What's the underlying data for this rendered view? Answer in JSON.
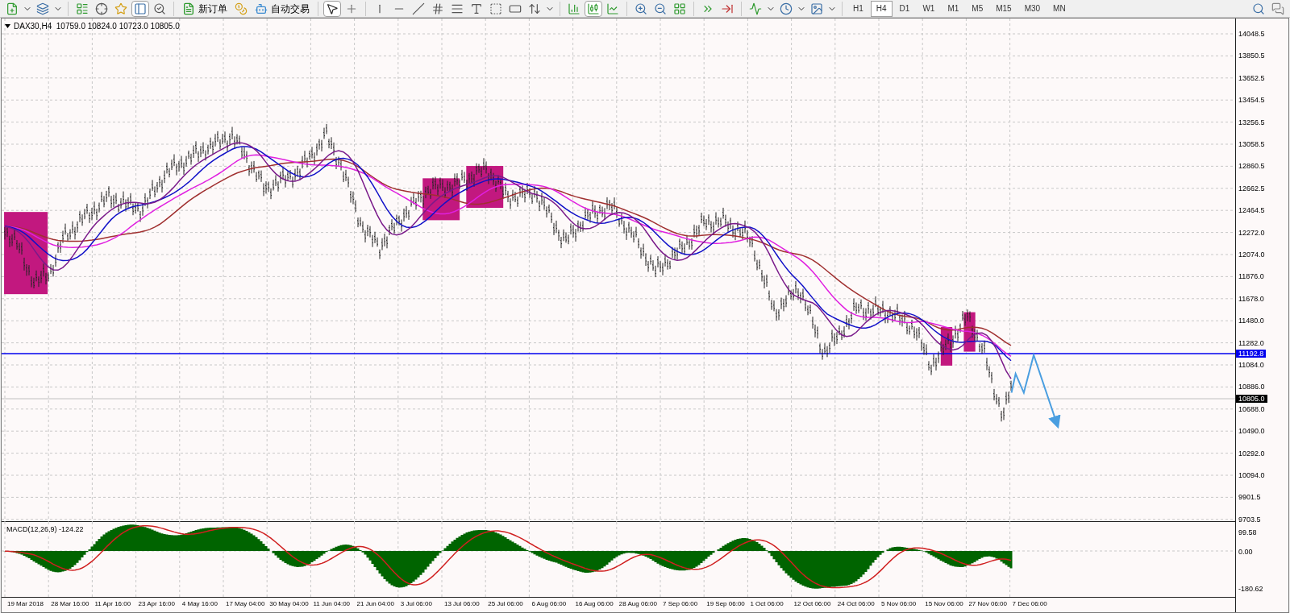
{
  "toolbar": {
    "buttons": [
      {
        "label": "新订单"
      },
      {
        "label": "自动交易"
      }
    ],
    "timeframes": [
      {
        "label": "H1",
        "selected": false
      },
      {
        "label": "H4",
        "selected": true
      },
      {
        "label": "D1",
        "selected": false
      },
      {
        "label": "W1",
        "selected": false
      },
      {
        "label": "M1",
        "selected": false
      },
      {
        "label": "M5",
        "selected": false
      },
      {
        "label": "M15",
        "selected": false
      },
      {
        "label": "M30",
        "selected": false
      },
      {
        "label": "MN",
        "selected": false
      }
    ]
  },
  "chart": {
    "header": "DAX30,H4  10759.0 10824.0 10723.0 10805.0",
    "price_axis": [
      "14048.5",
      "13850.5",
      "13652.5",
      "13454.5",
      "13256.5",
      "13058.5",
      "12860.5",
      "12662.5",
      "12464.5",
      "12272.0",
      "12074.0",
      "11876.0",
      "11678.0",
      "11480.0",
      "11282.0",
      "11084.0",
      "10886.0",
      "10688.0",
      "10490.0",
      "10292.0",
      "10094.0",
      "9901.5",
      "9703.5"
    ],
    "markers": [
      {
        "kind": "line",
        "text": "11192.8"
      },
      {
        "kind": "price",
        "text": "10805.0"
      }
    ],
    "macd": {
      "label": "MACD(12,26,9) -124.22",
      "axis": [
        "99.58",
        "0.00",
        "-180.62"
      ]
    },
    "time_axis": [
      "19 Mar 2018",
      "28 Mar 16:00",
      "11 Apr 16:00",
      "23 Apr 16:00",
      "4 May 16:00",
      "17 May 04:00",
      "30 May 04:00",
      "11 Jun 04:00",
      "21 Jun 04:00",
      "3 Jul 06:00",
      "13 Jul 06:00",
      "25 Jul 06:00",
      "6 Aug 06:00",
      "16 Aug 06:00",
      "28 Aug 06:00",
      "7 Sep 06:00",
      "19 Sep 06:00",
      "1 Oct 06:00",
      "12 Oct 06:00",
      "24 Oct 06:00",
      "5 Nov 06:00",
      "15 Nov 06:00",
      "27 Nov 06:00",
      "7 Dec 06:00"
    ]
  }
}
